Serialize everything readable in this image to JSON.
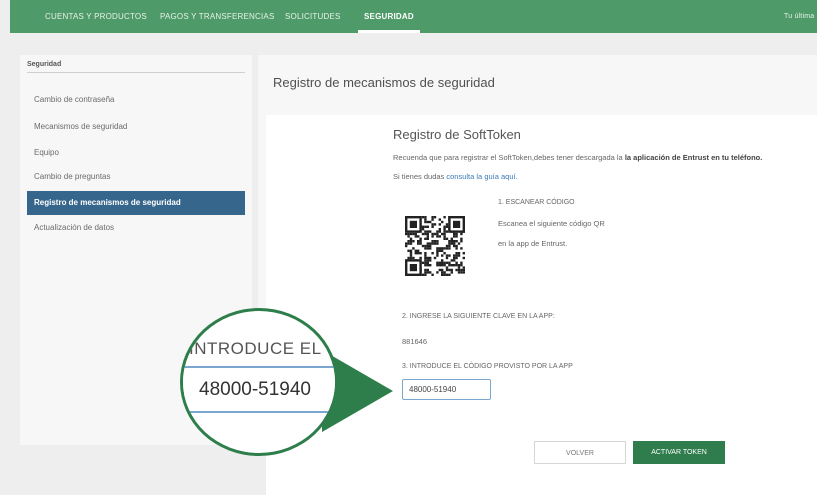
{
  "topnav": {
    "tabs": [
      {
        "label": "CUENTAS Y PRODUCTOS"
      },
      {
        "label": "PAGOS Y TRANSFERENCIAS"
      },
      {
        "label": "SOLICITUDES"
      },
      {
        "label": "SEGURIDAD"
      }
    ],
    "right_text": "Tu última"
  },
  "sidebar": {
    "heading": "Seguridad",
    "items": [
      {
        "label": "Cambio de contraseña"
      },
      {
        "label": "Mecanismos de seguridad"
      },
      {
        "label": "Equipo"
      },
      {
        "label": "Cambio de preguntas"
      },
      {
        "label": "Registro de mecanismos de seguridad"
      },
      {
        "label": "Actualización de datos"
      }
    ],
    "active_index": 4
  },
  "main": {
    "title": "Registro de mecanismos de seguridad",
    "section_title": "Registro de SoftToken",
    "description_prefix": "Recuenda que para registrar el SoftToken,debes tener descargada la ",
    "description_bold": "la aplicación de Entrust en tu teléfono.",
    "help_prefix": "Si tienes dudas ",
    "help_link": "consulta la guía aquí.",
    "step1_title": "1. ESCANEAR CÓDIGO",
    "step1_line1": "Escanea el siguiente código QR",
    "step1_line2": "en la app de Entrust.",
    "step2_label": "2. INGRESE LA SIGUIENTE CLAVE EN LA APP:",
    "step2_key": "881646",
    "step3_label": "3. INTRODUCE EL CÓDIGO PROVISTO POR LA APP",
    "step3_value": "48000-51940",
    "back_button": "VOLVER",
    "activate_button": "ACTIVAR TOKEN"
  },
  "zoom": {
    "label": "INTRODUCE EL CÓ",
    "value": "48000-51940"
  },
  "colors": {
    "nav_green": "#4e9a68",
    "active_blue": "#37668c",
    "button_green": "#2f7d4c",
    "callout_green": "#2d7e4a"
  }
}
